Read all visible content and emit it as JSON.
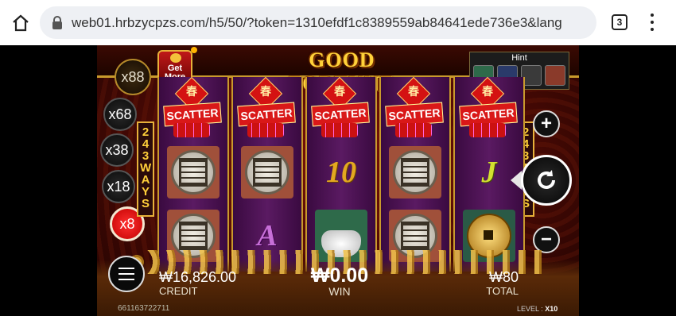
{
  "browser": {
    "url": "web01.hrbzycpzs.com/h5/50/?token=1310efdf1c8389559ab84641ede736e3&lang",
    "tab_count": "3"
  },
  "game": {
    "title": "GOOD FORTUNE",
    "get_more_label": "Get More",
    "hint_label": "Hint",
    "ways_label": "243WAYS",
    "multipliers": [
      "x88",
      "x68",
      "x38",
      "x18",
      "x8"
    ],
    "active_multiplier": "x8",
    "reels": [
      [
        "SCATTER",
        "coin-maze",
        "coin-maze"
      ],
      [
        "SCATTER",
        "coin-maze",
        "A"
      ],
      [
        "SCATTER",
        "10",
        "ingot"
      ],
      [
        "SCATTER",
        "coin-maze",
        "coin-maze"
      ],
      [
        "SCATTER",
        "J",
        "gold-coin"
      ]
    ],
    "scatter_char": "春",
    "credit": {
      "value": "₩16,826.00",
      "label": "CREDIT"
    },
    "win": {
      "value": "₩0.00",
      "label": "WIN"
    },
    "total": {
      "value": "₩80",
      "label": "TOTAL"
    },
    "session_id": "661163722711",
    "level": {
      "label": "LEVEL :",
      "value": "X10"
    },
    "colors": {
      "accent_gold": "#ffd23a",
      "active_red": "#e00000",
      "reel_purple": "#5a1a62"
    }
  }
}
